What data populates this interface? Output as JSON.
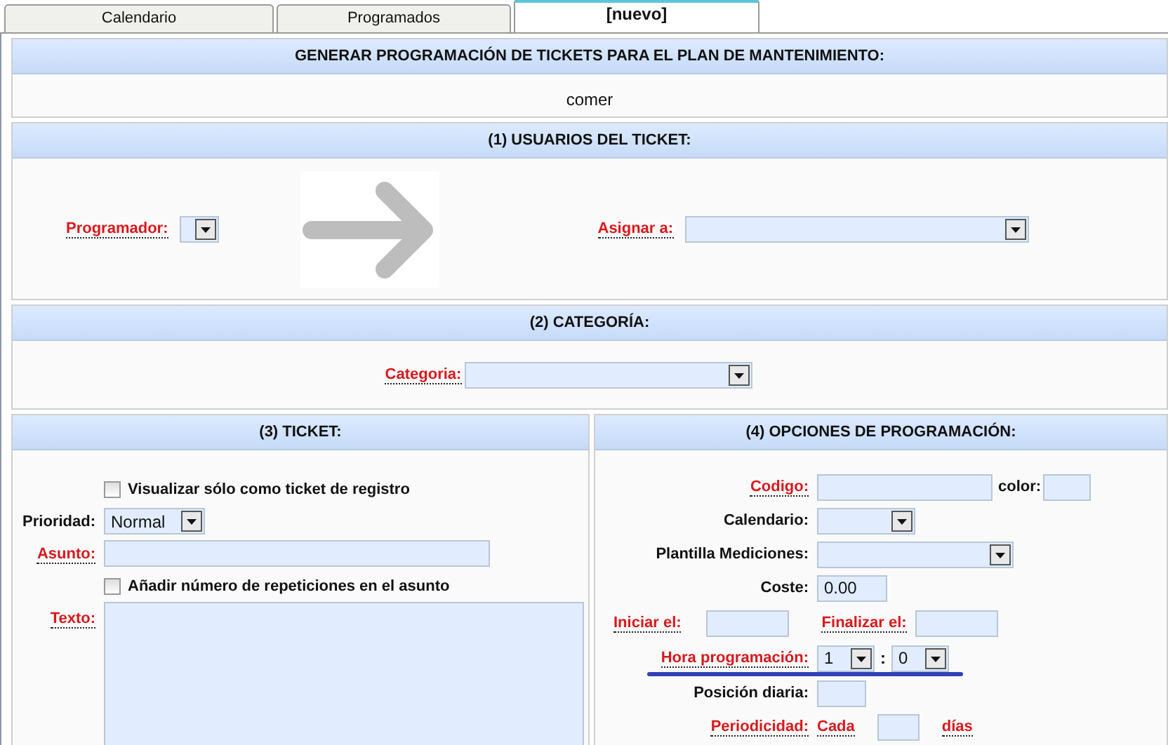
{
  "tabs": [
    {
      "label": "Calendario",
      "selected": false
    },
    {
      "label": "Programados",
      "selected": false
    },
    {
      "label": "[nuevo]",
      "selected": true
    }
  ],
  "header": {
    "title": "GENERAR PROGRAMACIÓN DE TICKETS PARA EL PLAN DE MANTENIMIENTO:",
    "plan": "comer"
  },
  "users": {
    "title": "(1) USUARIOS DEL TICKET:",
    "programmer": {
      "label": "Programador:",
      "required": true
    },
    "assign": {
      "label": "Asignar a:",
      "required": true
    }
  },
  "category": {
    "title": "(2) CATEGORÍA:",
    "field": {
      "label": "Categoria:",
      "required": true
    }
  },
  "ticket": {
    "title": "(3) TICKET:",
    "rows": [
      {
        "kind": "checkbox",
        "label": "Visualizar sólo como ticket de registro",
        "checked": false
      },
      {
        "kind": "select",
        "label": "Prioridad:",
        "required": false,
        "value": "Normal"
      },
      {
        "kind": "text",
        "label": "Asunto:",
        "required": true
      },
      {
        "kind": "checkbox",
        "label": "Añadir número de repeticiones en el asunto",
        "checked": false
      },
      {
        "kind": "textarea",
        "label": "Texto:",
        "required": true
      }
    ]
  },
  "options": {
    "title": "(4) OPCIONES DE PROGRAMACIÓN:",
    "rows": [
      {
        "kind": "code",
        "label": "Codigo:",
        "required": true,
        "color_label": "color:"
      },
      {
        "kind": "select",
        "label": "Calendario:",
        "required": false
      },
      {
        "kind": "select",
        "label": "Plantilla Mediciones:",
        "required": false
      },
      {
        "kind": "text",
        "label": "Coste:",
        "required": false,
        "value": "0.00"
      },
      {
        "kind": "dates",
        "start": {
          "label": "Iniciar el:",
          "required": true
        },
        "end": {
          "label": "Finalizar el:",
          "required": true
        }
      },
      {
        "kind": "time",
        "label": "Hora programación:",
        "required": true,
        "hour": "1",
        "separator": ":",
        "minute": "0",
        "underlined": true
      },
      {
        "kind": "text",
        "label": "Posición diaria:",
        "required": false
      },
      {
        "kind": "period",
        "label": "Periodicidad:",
        "required": true,
        "every": "Cada",
        "unit": "días"
      }
    ]
  }
}
